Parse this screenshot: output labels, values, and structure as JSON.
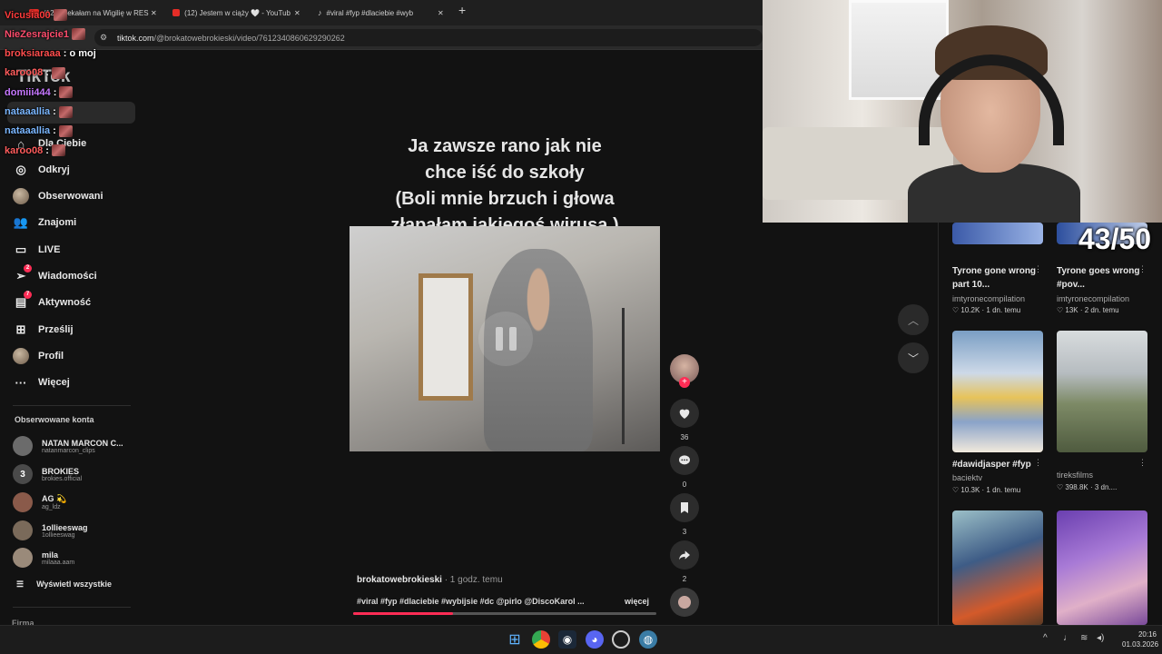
{
  "browser": {
    "tabs": [
      {
        "title": "(12) Czekałam na Wigilię w RES"
      },
      {
        "title": "(12) Jestem w ciąży 🤍 - YouTub"
      },
      {
        "title": "#viral #fyp #dlaciebie #wyb"
      }
    ],
    "url_domain": "tiktok.com",
    "url_path": "/@brokatowebrokieski/video/7612340860629290262"
  },
  "tiktok": {
    "logo": "TikTok",
    "nav": [
      {
        "label": "Dla Ciebie",
        "icon": "home-icon"
      },
      {
        "label": "Odkryj",
        "icon": "compass-icon"
      },
      {
        "label": "Obserwowani",
        "icon": "avatar-icon"
      },
      {
        "label": "Znajomi",
        "icon": "friends-icon"
      },
      {
        "label": "LIVE",
        "icon": "live-icon"
      },
      {
        "label": "Wiadomości",
        "icon": "send-icon",
        "badge": "2"
      },
      {
        "label": "Aktywność",
        "icon": "inbox-icon",
        "badge": "7"
      },
      {
        "label": "Prześlij",
        "icon": "upload-icon"
      },
      {
        "label": "Profil",
        "icon": "profile-icon"
      },
      {
        "label": "Więcej",
        "icon": "more-icon"
      }
    ],
    "followed_title": "Obserwowane konta",
    "followed": [
      {
        "name": "NATAN MARCON C...",
        "handle": "natanmarcon_clips"
      },
      {
        "name": "BROKIES",
        "handle": "brokies.official"
      },
      {
        "name": "AG 💫",
        "handle": "ag_ldz"
      },
      {
        "name": "1ollieeswag",
        "handle": "1ollieeswag"
      },
      {
        "name": "mila",
        "handle": "milaaa.aam"
      }
    ],
    "see_all": "Wyświetl wszystkie",
    "footer": "Firma"
  },
  "chat": [
    {
      "user": "Vicusia00",
      "color": "#ff3b3b",
      "msg": ""
    },
    {
      "user": "NieZesrajcie1",
      "color": "#ff4d6d",
      "msg": ""
    },
    {
      "user": "broksiaraaa",
      "color": "#ff4d4d",
      "msg": ": o moj"
    },
    {
      "user": "karoo08",
      "color": "#ff5c5c",
      "msg": ":"
    },
    {
      "user": "domiii444",
      "color": "#c678ff",
      "msg": ":"
    },
    {
      "user": "nataaallia",
      "color": "#7ab6ff",
      "msg": ":"
    },
    {
      "user": "nataaallia",
      "color": "#7ab6ff",
      "msg": ":"
    },
    {
      "user": "karoo08",
      "color": "#ff5c5c",
      "msg": ":"
    }
  ],
  "video": {
    "caption_lines": [
      "Ja zawsze rano jak nie",
      "chce iść do szkoły",
      "(Boli mnie brzuch i głowa",
      "złapałam jakiegoś wirusa )"
    ],
    "author": "brokatowebrokieski",
    "time": "· 1 godz. temu",
    "tags": "#viral #fyp #dlaciebie #wybijsie #dc @pirlo @DiscoKarol ...",
    "more": "więcej",
    "progress": 0.33,
    "likes": "36",
    "comments": "0",
    "saves": "3",
    "shares": "2"
  },
  "related": [
    {
      "title": "Tyrone gone wrong part 10...",
      "user": "imtyronecompilation",
      "meta": "10.2K · 1 dn. temu"
    },
    {
      "title": "Tyrone goes wrong #pov...",
      "user": "imtyronecompilation",
      "meta": "13K · 2 dn. temu"
    },
    {
      "title": "#dawidjasper #fyp",
      "user": "baciektv",
      "meta": "10.3K · 1 dn. temu"
    },
    {
      "title": "",
      "user": "tireksfilms",
      "meta": "398.8K · 3 dn...."
    }
  ],
  "overlay": {
    "score": "43/50"
  },
  "taskbar": {
    "time": "20:16",
    "date": "01.03.2026"
  },
  "colors": {
    "accent": "#fe2c55",
    "bg": "#121212"
  }
}
